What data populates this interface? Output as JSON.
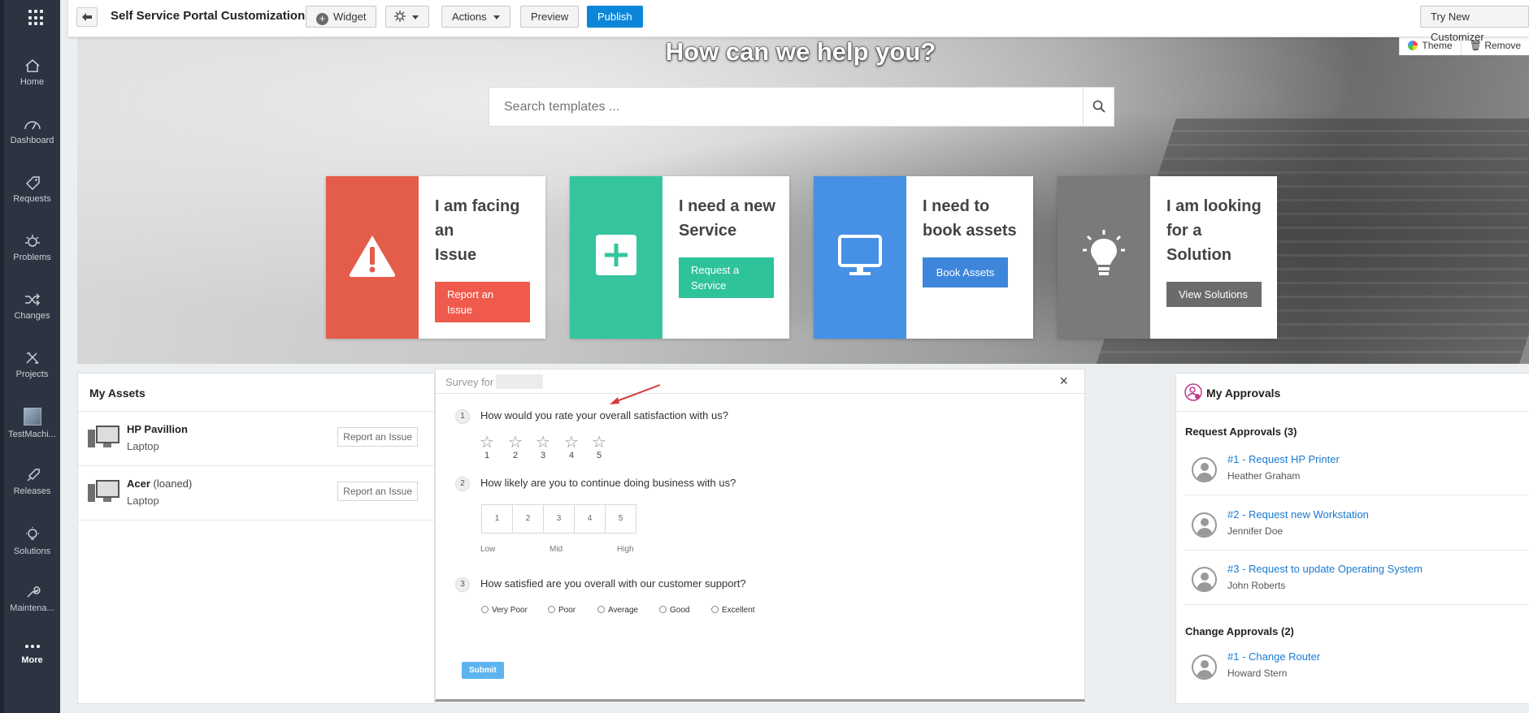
{
  "sidebar": {
    "items": [
      {
        "label": "Home",
        "icon": "home-icon"
      },
      {
        "label": "Dashboard",
        "icon": "dashboard-icon"
      },
      {
        "label": "Requests",
        "icon": "requests-icon"
      },
      {
        "label": "Problems",
        "icon": "problems-icon"
      },
      {
        "label": "Changes",
        "icon": "changes-icon"
      },
      {
        "label": "Projects",
        "icon": "projects-icon"
      },
      {
        "label": "TestMachi...",
        "icon": "test-machine-thumbnail"
      },
      {
        "label": "Releases",
        "icon": "releases-icon"
      },
      {
        "label": "Solutions",
        "icon": "solutions-icon"
      },
      {
        "label": "Maintena...",
        "icon": "maintenance-icon"
      },
      {
        "label": "More",
        "icon": "more-icon"
      }
    ]
  },
  "toolbar": {
    "title": "Self Service Portal Customization",
    "widget_label": "Widget",
    "actions_label": "Actions",
    "preview_label": "Preview",
    "publish_label": "Publish",
    "try_new_label": "Try New Customizer"
  },
  "hero": {
    "title": "How can we help you?",
    "search_placeholder": "Search templates ...",
    "theme_label": "Theme",
    "remove_label": "Remove"
  },
  "cards": [
    {
      "title": "I am facing an Issue",
      "title_lines": [
        "I am facing",
        "an",
        "Issue"
      ],
      "button": "Report an Issue",
      "color": "#e45c4a",
      "btn_color": "#f05a4c"
    },
    {
      "title": "I need a new Service",
      "title_lines": [
        "I need a new",
        "Service"
      ],
      "button": "Request a Service",
      "color": "#35c59e",
      "btn_color": "#2fc39b"
    },
    {
      "title": "I need to book assets",
      "title_lines": [
        "I need to",
        "book assets"
      ],
      "button": "Book Assets",
      "color": "#4690e5",
      "btn_color": "#3d86db"
    },
    {
      "title": "I am looking for a Solution",
      "title_lines": [
        "I am looking",
        "for a",
        "Solution"
      ],
      "button": "View Solutions",
      "color": "#7a7a7a",
      "btn_color": "#6b6b6b"
    }
  ],
  "assets": {
    "title": "My Assets",
    "items": [
      {
        "name": "HP Pavillion",
        "suffix": "",
        "type": "Laptop",
        "action": "Report an Issue"
      },
      {
        "name": "Acer",
        "suffix": "(loaned)",
        "type": "Laptop",
        "action": "Report an Issue"
      }
    ]
  },
  "survey": {
    "header": "Survey for",
    "close": "×",
    "questions": [
      {
        "num": "1",
        "text": "How would you rate your overall satisfaction with us?",
        "options": [
          "1",
          "2",
          "3",
          "4",
          "5"
        ]
      },
      {
        "num": "2",
        "text": "How likely are you to continue doing business with us?",
        "options": [
          "1",
          "2",
          "3",
          "4",
          "5"
        ],
        "scale_labels": [
          "Low",
          "Mid",
          "High"
        ]
      },
      {
        "num": "3",
        "text": "How satisfied are you overall with our customer support?",
        "options": [
          "Very Poor",
          "Poor",
          "Average",
          "Good",
          "Excellent"
        ]
      }
    ],
    "submit": "Submit"
  },
  "approvals": {
    "title": "My Approvals",
    "request_section": "Request Approvals (3)",
    "requests": [
      {
        "title": "#1 - Request HP Printer",
        "user": "Heather Graham"
      },
      {
        "title": "#2 - Request new Workstation",
        "user": "Jennifer Doe"
      },
      {
        "title": "#3 - Request to update Operating System",
        "user": "John Roberts"
      }
    ],
    "change_section": "Change Approvals (2)",
    "changes": [
      {
        "title": "#1 - Change Router",
        "user": "Howard Stern"
      }
    ]
  },
  "colors": {
    "sidebar_bg": "#2b3440",
    "publish": "#0b86d8",
    "link": "#1a7ad0"
  }
}
